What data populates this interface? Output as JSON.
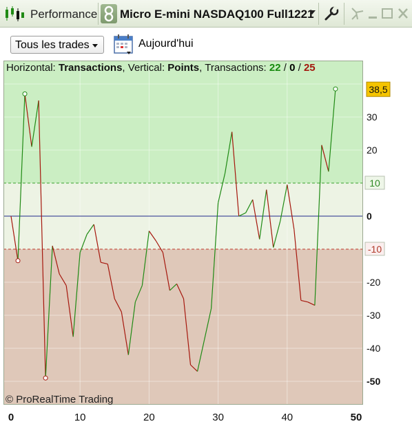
{
  "window": {
    "tab_title": "Performance",
    "instrument_title": "Micro E-mini NASDAQ100 Full1221",
    "icons": [
      "candlestick-icon",
      "link-icon",
      "chevron-down-icon",
      "wrench-icon",
      "pin-icon",
      "minimize-icon",
      "maximize-icon",
      "close-icon"
    ]
  },
  "toolbar": {
    "trades_filter": "Tous les trades",
    "date_label": "Aujourd'hui"
  },
  "header": {
    "horizontal_label": "Horizontal:",
    "horizontal_value": "Transactions",
    "vertical_label": "Vertical:",
    "vertical_value": "Points",
    "transactions_label": "Transactions:",
    "winners": "22",
    "neutral": "0",
    "losers": "25",
    "sep": "/"
  },
  "copyright": "© ProRealTime Trading",
  "colors": {
    "upper_zone": "#cbeec3",
    "middle_zone": "#edf3e4",
    "lower_zone": "#dfc8b9",
    "up_segment": "#1f8a14",
    "down_segment": "#a5160c",
    "zero_line": "#1f2a8a",
    "last_value_badge": "#f5c400"
  },
  "chart_data": {
    "type": "line",
    "xlabel": "",
    "ylabel": "",
    "xlim": [
      0,
      50
    ],
    "ylim": [
      -57,
      40
    ],
    "x_ticks": [
      "0",
      "10",
      "20",
      "30",
      "40",
      "50"
    ],
    "y_ticks": [
      "30",
      "20",
      "-10",
      "-20",
      "-30",
      "-40",
      "-50"
    ],
    "y_tick_labels": [
      "30",
      "20",
      "10",
      "0",
      "-10",
      "-20",
      "-30",
      "-40",
      "-50"
    ],
    "zone_lines": [
      10,
      -10
    ],
    "last_value_label": "38,5",
    "min_label": "-50",
    "series": [
      {
        "x": [
          0,
          1,
          2,
          3,
          4,
          5,
          6,
          7,
          8,
          9,
          10,
          11,
          12,
          13,
          14,
          15,
          16,
          17,
          18,
          19,
          20,
          21,
          22,
          23,
          24,
          25,
          26,
          27,
          28,
          29,
          30,
          31,
          32,
          33,
          34,
          35,
          36,
          37,
          38,
          39,
          40,
          41,
          42,
          43,
          44,
          45,
          46,
          47
        ],
        "values": [
          0,
          -13.5,
          37,
          21,
          35,
          -49,
          -9,
          -17.5,
          -21,
          -36.5,
          -11,
          -5.5,
          -2.5,
          -14,
          -14.5,
          -25,
          -29,
          -42,
          -26,
          -21,
          -4.5,
          -7.5,
          -11,
          -22.5,
          -20.5,
          -25,
          -45,
          -47,
          -37.5,
          -28,
          4,
          13,
          25.5,
          0,
          1,
          5,
          -7,
          8,
          -9.5,
          -1.5,
          9.5,
          -4,
          -25.5,
          -26,
          -27,
          21.5,
          13.5,
          38.5
        ]
      }
    ]
  }
}
